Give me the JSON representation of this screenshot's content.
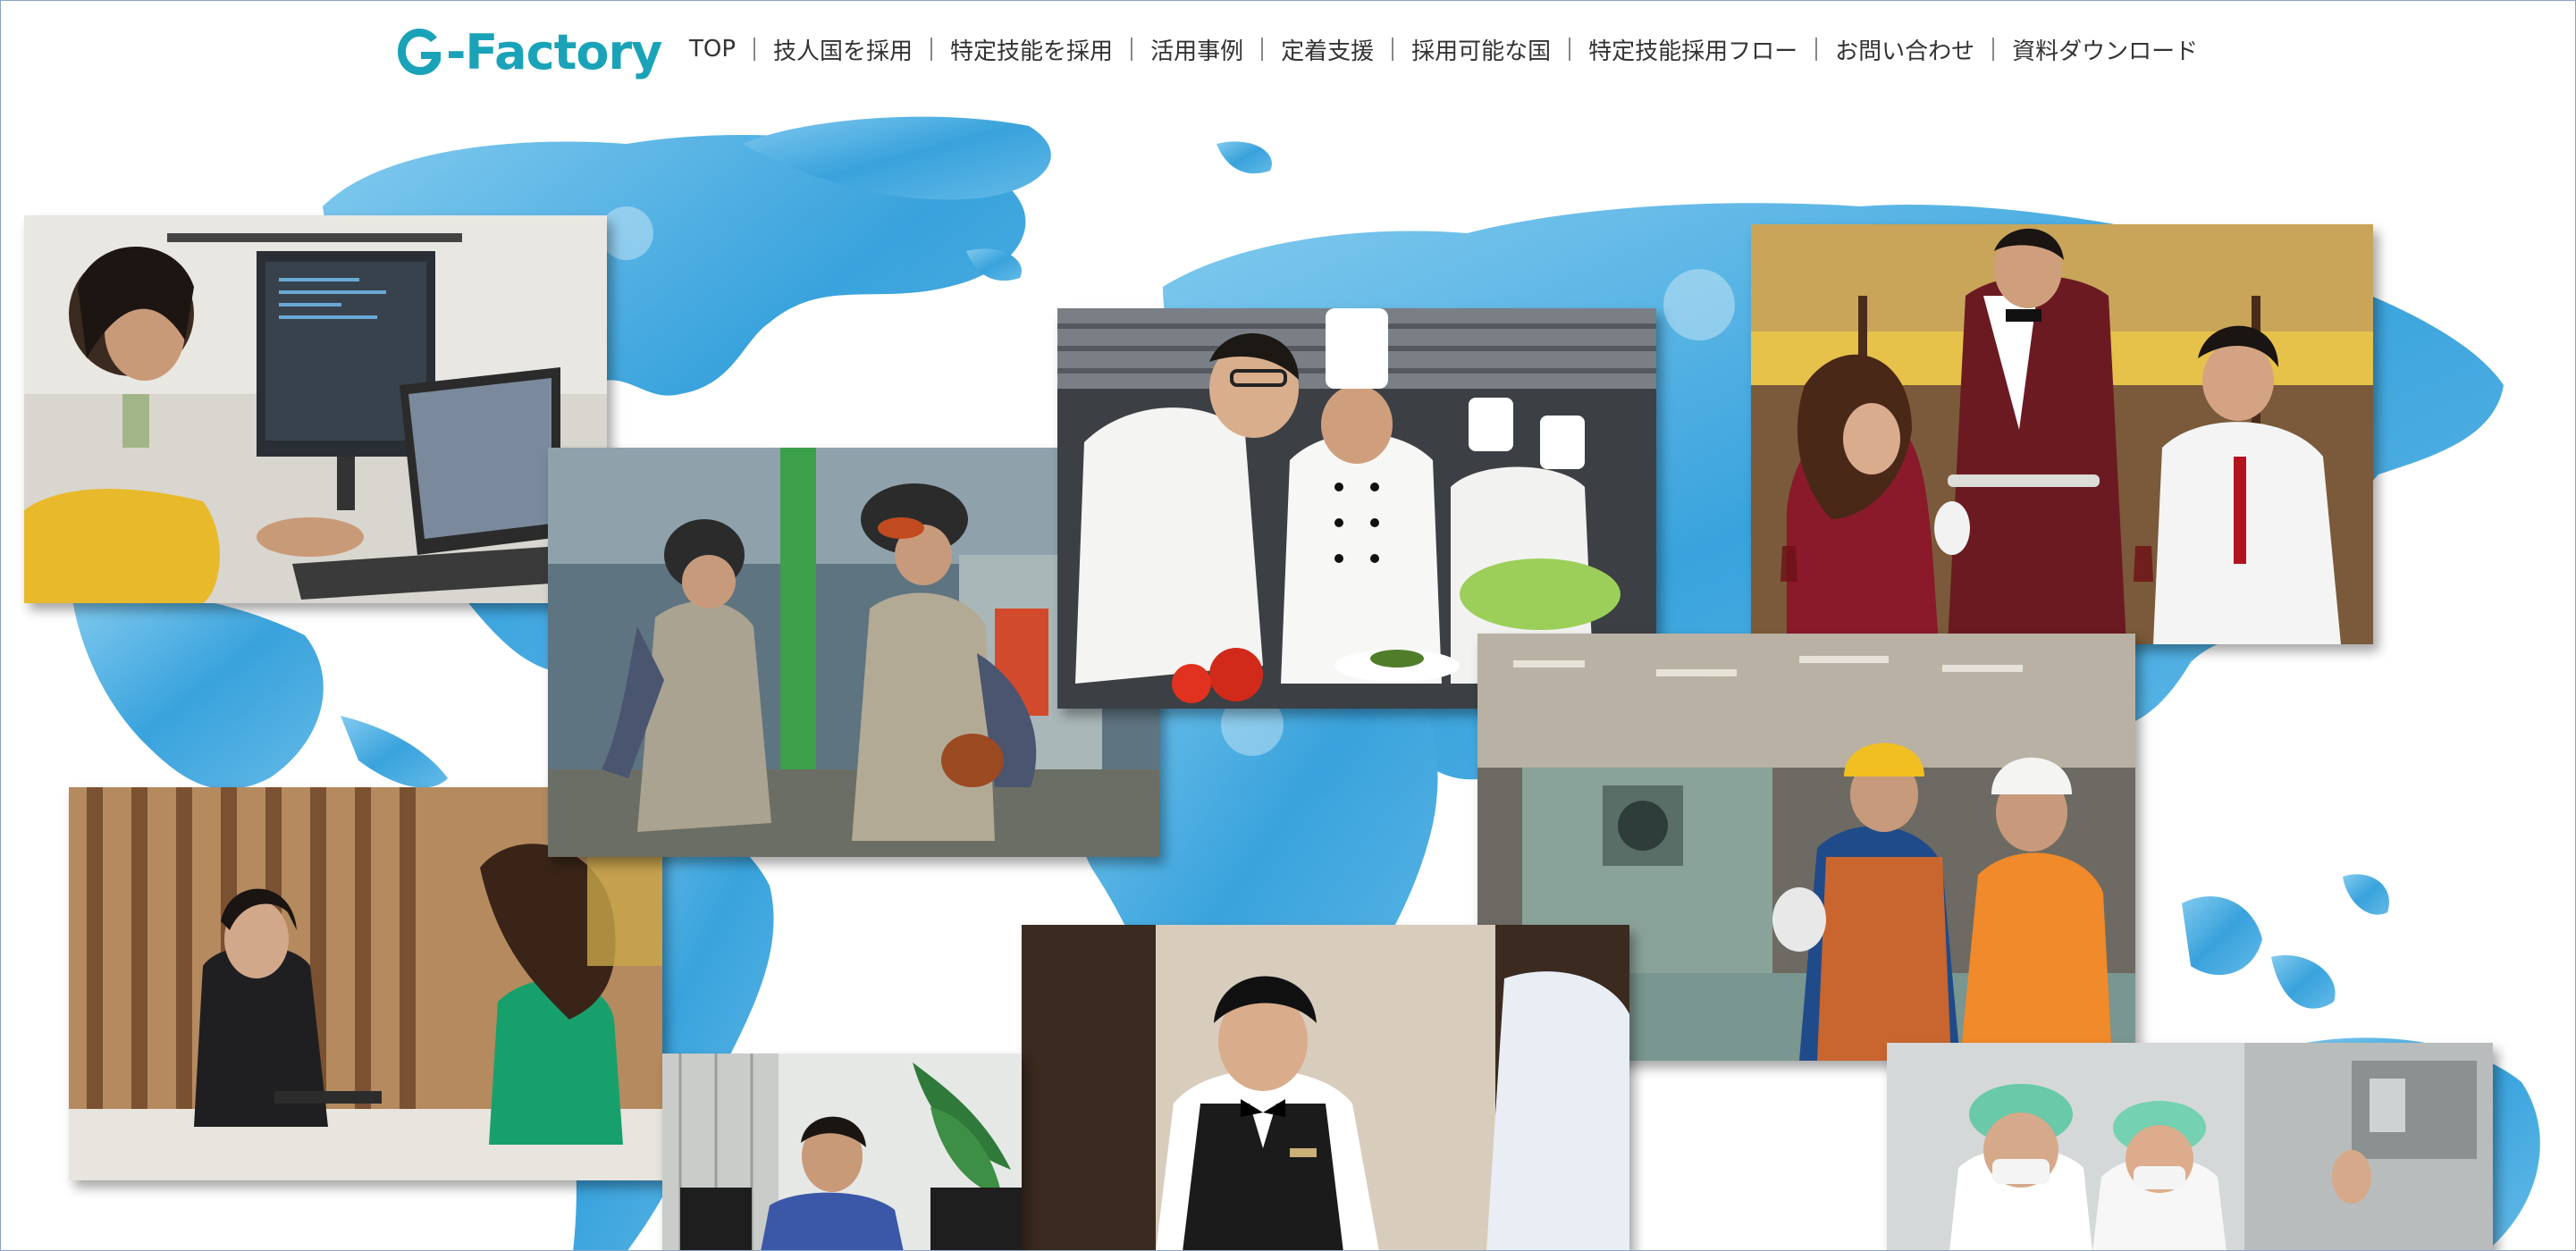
{
  "brand": {
    "logo_text": "-Factory",
    "logo_icon": "g-letter-logo-icon",
    "color": "#1aa3b8"
  },
  "nav": {
    "items": [
      {
        "label": "TOP"
      },
      {
        "label": "技人国を採用"
      },
      {
        "label": "特定技能を採用"
      },
      {
        "label": "活用事例"
      },
      {
        "label": "定着支援"
      },
      {
        "label": "採用可能な国"
      },
      {
        "label": "特定技能採用フロー"
      },
      {
        "label": "お問い合わせ"
      },
      {
        "label": "資料ダウンロード"
      }
    ]
  },
  "hero": {
    "background": "world-map-watercolor",
    "map_color": "#3aa6dc",
    "photos": [
      {
        "subject": "woman-coding-at-desk-photo"
      },
      {
        "subject": "welders-with-masks-photo"
      },
      {
        "subject": "chefs-cooking-photo"
      },
      {
        "subject": "restaurant-waiter-serving-couple-photo"
      },
      {
        "subject": "hotel-reception-photo"
      },
      {
        "subject": "factory-engineers-photo"
      },
      {
        "subject": "waiter-in-bowtie-photo"
      },
      {
        "subject": "office-worker-photo"
      },
      {
        "subject": "food-factory-workers-photo"
      }
    ]
  }
}
